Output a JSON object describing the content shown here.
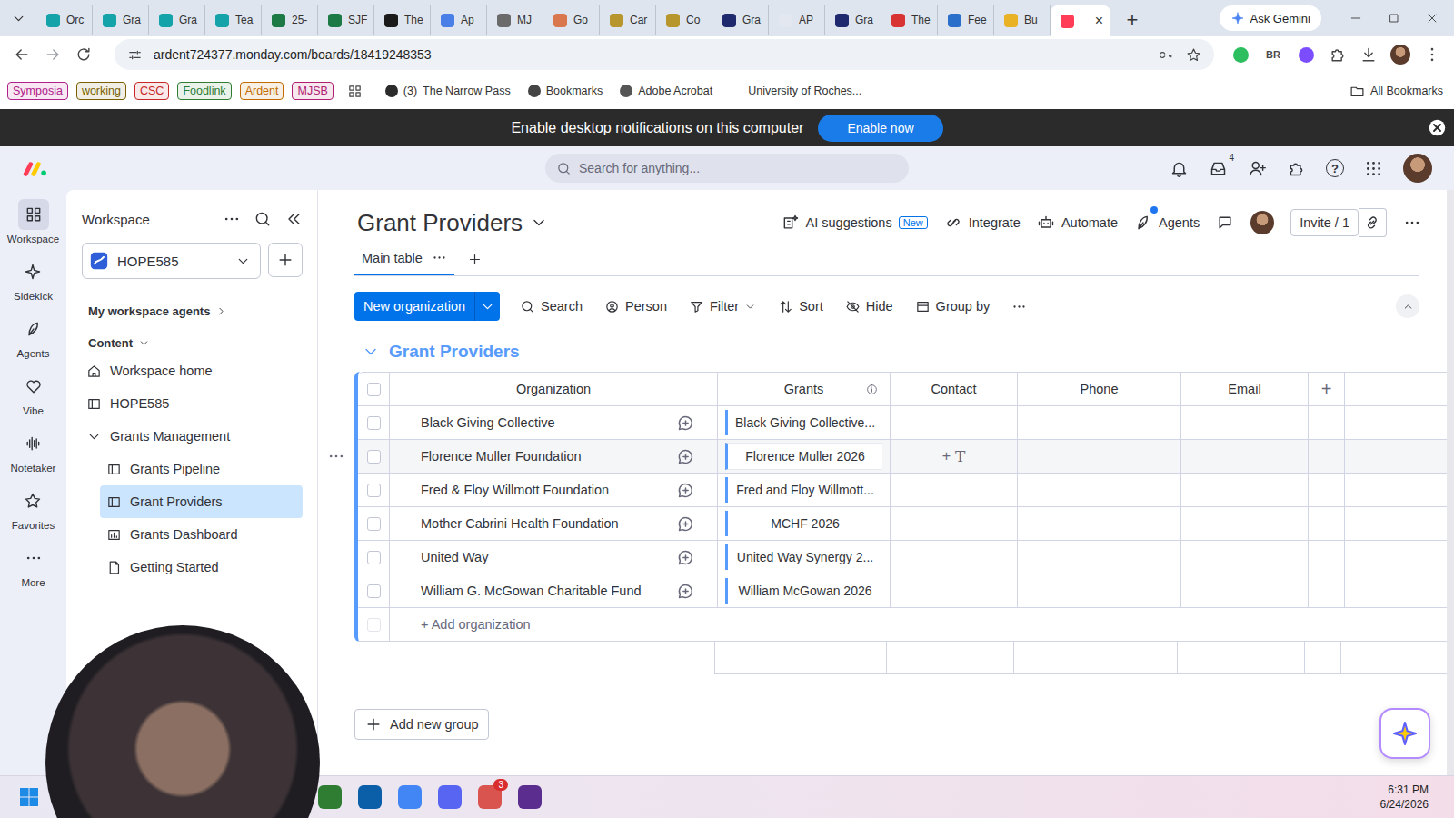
{
  "browser": {
    "tabs": [
      {
        "label": "Orc",
        "color": "#14a3a8",
        "selected": false
      },
      {
        "label": "Gra",
        "color": "#14a3a8",
        "selected": false
      },
      {
        "label": "Gra",
        "color": "#14a3a8",
        "selected": false
      },
      {
        "label": "Tea",
        "color": "#14a3a8",
        "selected": false
      },
      {
        "label": "25-",
        "color": "#1d7a45",
        "selected": false
      },
      {
        "label": "SJF",
        "color": "#1d7a45",
        "selected": false
      },
      {
        "label": "The",
        "color": "#1b1b1b",
        "selected": false
      },
      {
        "label": "Ap",
        "color": "#4a7fe8",
        "selected": false
      },
      {
        "label": "MJ",
        "color": "#6b6b6b",
        "selected": false
      },
      {
        "label": "Go",
        "color": "#d9774f",
        "selected": false
      },
      {
        "label": "Car",
        "color": "#b8962e",
        "selected": false
      },
      {
        "label": "Co",
        "color": "#b8962e",
        "selected": false
      },
      {
        "label": "Gra",
        "color": "#1f2a6e",
        "selected": false
      },
      {
        "label": "AP",
        "color": "#e3e8f0",
        "selected": false
      },
      {
        "label": "Gra",
        "color": "#1f2a6e",
        "selected": false
      },
      {
        "label": "The",
        "color": "#d93434",
        "selected": false
      },
      {
        "label": "Fee",
        "color": "#2a6fc9",
        "selected": false
      },
      {
        "label": "Bu",
        "color": "#e8b224",
        "selected": false
      },
      {
        "label": "",
        "color": "#ff3d57",
        "selected": true
      }
    ],
    "tab_close": "×",
    "new_tab": "+",
    "gemini": "Ask Gemini",
    "url": "ardent724377.monday.com/boards/18419248353",
    "extensions": [
      {
        "label": "",
        "color": "#2dbe60"
      },
      {
        "label": "BR",
        "color": "#4a4a4a"
      },
      {
        "label": "",
        "color": "#7c4dff"
      }
    ],
    "bookmarks": [
      {
        "label": "Symposia",
        "kind": "chip",
        "badge": "",
        "color": "#b0208a"
      },
      {
        "label": "working",
        "kind": "chip",
        "badge": "",
        "color": "#7a6000"
      },
      {
        "label": "CSC",
        "kind": "chip",
        "badge": "",
        "color": "#c62828"
      },
      {
        "label": "Foodlink",
        "kind": "chip",
        "badge": "",
        "color": "#2e7d32"
      },
      {
        "label": "Ardent",
        "kind": "chip",
        "badge": "",
        "color": "#c26a00"
      },
      {
        "label": "MJSB",
        "kind": "chip",
        "badge": "",
        "color": "#b0206e"
      },
      {
        "label": "",
        "kind": "apps",
        "badge": "",
        "color": "#444444"
      },
      {
        "label": "The Narrow Pass",
        "kind": "link",
        "badge": "(3)",
        "color": "#2b2b2b"
      },
      {
        "label": "Bookmarks",
        "kind": "link",
        "badge": "",
        "color": "#444444"
      },
      {
        "label": "Adobe Acrobat",
        "kind": "link",
        "badge": "",
        "color": "#555555"
      },
      {
        "label": "University of Roches...",
        "kind": "link",
        "badge": "",
        "color": "#ffffff"
      }
    ],
    "all_bookmarks": "All Bookmarks"
  },
  "banner": {
    "text": "Enable desktop notifications on this computer",
    "button": "Enable now"
  },
  "header": {
    "search_placeholder": "Search for anything...",
    "inbox_badge": "4",
    "help": "?"
  },
  "rail": [
    {
      "label": "Workspace",
      "selected": true
    },
    {
      "label": "Sidekick",
      "selected": false
    },
    {
      "label": "Agents",
      "selected": false
    },
    {
      "label": "Vibe",
      "selected": false
    },
    {
      "label": "Notetaker",
      "selected": false
    },
    {
      "label": "Favorites",
      "selected": false
    },
    {
      "label": "More",
      "selected": false
    }
  ],
  "sidebar": {
    "title": "Workspace",
    "workspace": "HOPE585",
    "agents": "My workspace agents",
    "section": "Content",
    "section_expanded": true,
    "items": [
      {
        "label": "Workspace home",
        "selected": false
      },
      {
        "label": "HOPE585",
        "selected": false
      },
      {
        "label": "Grants Management",
        "selected": false,
        "expanded": true,
        "children": [
          {
            "label": "Grants Pipeline",
            "selected": false
          },
          {
            "label": "Grant Providers",
            "selected": true
          },
          {
            "label": "Grants Dashboard",
            "selected": false
          },
          {
            "label": "Getting Started",
            "selected": false
          }
        ]
      }
    ]
  },
  "board": {
    "title": "Grant Providers",
    "views": [
      {
        "label": "Main table",
        "selected": true
      }
    ],
    "actions": [
      {
        "label": "AI suggestions",
        "badge": "New",
        "dot": false
      },
      {
        "label": "Integrate",
        "badge": "",
        "dot": false
      },
      {
        "label": "Automate",
        "badge": "",
        "dot": false
      },
      {
        "label": "Agents",
        "badge": "",
        "dot": true
      }
    ],
    "invite": "Invite / 1",
    "primary": "New organization",
    "toolbar": [
      {
        "label": "Search",
        "dropdown": false
      },
      {
        "label": "Person",
        "dropdown": false
      },
      {
        "label": "Filter",
        "dropdown": true
      },
      {
        "label": "Sort",
        "dropdown": false
      },
      {
        "label": "Hide",
        "dropdown": false
      },
      {
        "label": "Group by",
        "dropdown": false
      }
    ]
  },
  "group": {
    "title": "Grant Providers",
    "color": "#579bfc",
    "expanded": true
  },
  "table": {
    "columns": [
      {
        "label": "Organization",
        "info": false
      },
      {
        "label": "Grants",
        "info": true
      },
      {
        "label": "Contact",
        "info": false
      },
      {
        "label": "Phone",
        "info": false
      },
      {
        "label": "Email",
        "info": false
      }
    ],
    "add_column": "+",
    "rows": [
      {
        "organization": "Black Giving Collective",
        "grants": "Black Giving Collective...",
        "contact": "",
        "phone": "",
        "email": "",
        "hovered": false,
        "checked": false
      },
      {
        "organization": "Florence Muller Foundation",
        "grants": "Florence Muller 2026",
        "contact": "",
        "phone": "",
        "email": "",
        "hovered": true,
        "checked": false
      },
      {
        "organization": "Fred & Floy Willmott Foundation",
        "grants": "Fred and Floy Willmott...",
        "contact": "",
        "phone": "",
        "email": "",
        "hovered": false,
        "checked": false
      },
      {
        "organization": "Mother Cabrini Health Foundation",
        "grants": "MCHF 2026",
        "contact": "",
        "phone": "",
        "email": "",
        "hovered": false,
        "checked": false
      },
      {
        "organization": "United Way",
        "grants": "United Way Synergy 2...",
        "contact": "",
        "phone": "",
        "email": "",
        "hovered": false,
        "checked": false
      },
      {
        "organization": "William G. McGowan Charitable Fund",
        "grants": "William McGowan 2026",
        "contact": "",
        "phone": "",
        "email": "",
        "hovered": false,
        "checked": false
      }
    ],
    "hover_hint": {
      "plus": "+",
      "icon": "T"
    },
    "add_row": "+ Add organization"
  },
  "add_group": "Add new group",
  "taskbar": {
    "apps": [
      {
        "color": "#2e7d32",
        "badge": ""
      },
      {
        "color": "#0a5fa8",
        "badge": ""
      },
      {
        "color": "#4285f4",
        "badge": ""
      },
      {
        "color": "#5865f2",
        "badge": ""
      },
      {
        "color": "#d9534f",
        "badge": "3"
      },
      {
        "color": "#5b2d8e",
        "badge": ""
      }
    ],
    "time": "6:31 PM",
    "date": "6/24/2026"
  }
}
